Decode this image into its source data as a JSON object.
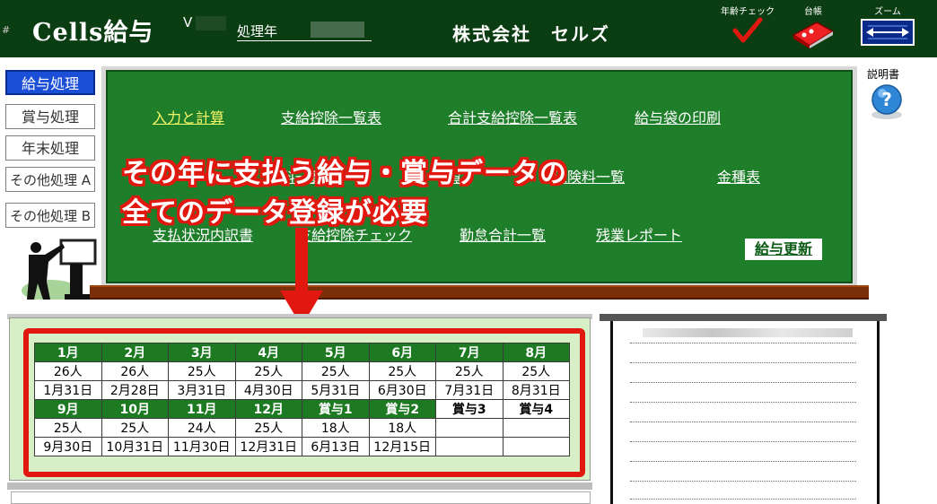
{
  "header": {
    "hash": "#",
    "app_title": "Cells給与",
    "version_label": "V",
    "year_label": "処理年",
    "company": "株式会社　セルズ",
    "age_check_label": "年齢チェック",
    "ledger_label": "台帳",
    "zoom_label": "ズーム"
  },
  "nav": {
    "salary": "給与処理",
    "bonus": "賞与処理",
    "yearend": "年末処理",
    "other_a": "その他処理 A",
    "other_b": "その他処理 B"
  },
  "board": {
    "row1": [
      "入力と計算",
      "支給控除一覧表",
      "合計支給控除一覧表",
      "給与袋の印刷"
    ],
    "row2": [
      "給",
      "料一覧表",
      "覧",
      "保険料一覧",
      "金種表"
    ],
    "row3": [
      "支払状況内訳書",
      "支給控除チェック",
      "勤怠合計一覧",
      "残業レポート"
    ],
    "update": "給与更新",
    "highlight_color": "#f7f76a"
  },
  "help": {
    "label": "説明書"
  },
  "caption": {
    "line1": "その年に支払う給与・賞与データの",
    "line2": "全てのデータ登録が必要"
  },
  "calendar": {
    "rows": [
      {
        "headers": [
          "1月",
          "2月",
          "3月",
          "4月",
          "5月",
          "6月",
          "7月",
          "8月"
        ],
        "counts": [
          "26人",
          "26人",
          "25人",
          "25人",
          "25人",
          "25人",
          "25人",
          "25人"
        ],
        "dates": [
          "1月31日",
          "2月28日",
          "3月31日",
          "4月30日",
          "5月31日",
          "6月30日",
          "7月31日",
          "8月31日"
        ]
      },
      {
        "headers": [
          "9月",
          "10月",
          "11月",
          "12月",
          "賞与1",
          "賞与2",
          "賞与3",
          "賞与4"
        ],
        "counts": [
          "25人",
          "25人",
          "24人",
          "25人",
          "18人",
          "18人",
          "",
          ""
        ],
        "dates": [
          "9月30日",
          "10月31日",
          "11月30日",
          "12月31日",
          "6月13日",
          "12月15日",
          "",
          ""
        ]
      }
    ]
  },
  "colors": {
    "header_bg": "#0b3d12",
    "board_bg": "#1f7e2a",
    "accent_red": "#e0180f",
    "nav_active": "#1b4fd8"
  }
}
